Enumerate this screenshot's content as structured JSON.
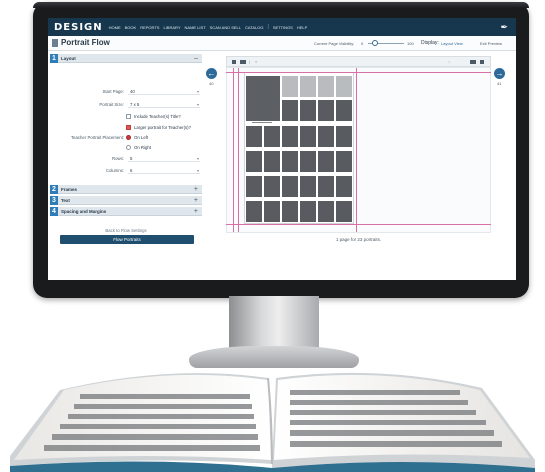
{
  "app": {
    "logo": "DESIGN",
    "nav": [
      "HOME",
      "BOOK",
      "REPORTS",
      "LIBRARY",
      "NAME LIST",
      "SCAN AND SELL",
      "CATALOG",
      "SETTINGS",
      "HELP"
    ],
    "nav_separator_after": 6
  },
  "header": {
    "title": "Portrait Flow",
    "visibility_label": "Current Page Visibility:",
    "visibility_min": "0",
    "visibility_max": "100",
    "visibility_value": 0.2,
    "display_label": "Display:",
    "layout_view": "Layout View",
    "exit_preview": "Exit Preview"
  },
  "sections": [
    {
      "num": "1",
      "label": "Layout",
      "toggle": "–"
    },
    {
      "num": "2",
      "label": "Frames",
      "toggle": "+"
    },
    {
      "num": "3",
      "label": "Text",
      "toggle": "+"
    },
    {
      "num": "4",
      "label": "Spacing and Margins",
      "toggle": "+"
    }
  ],
  "layout_form": {
    "start_page_label": "Start Page:",
    "start_page_value": "40",
    "portrait_size_label": "Portrait Size:",
    "portrait_size_value": "7 x 5",
    "include_teacher_title": "Include Teacher(s) Title?",
    "larger_portrait": "Larger portrait for Teacher(s)?",
    "teacher_placement_label": "Teacher Portrait Placement:",
    "placement_left": "On Left",
    "placement_right": "On Right",
    "rows_label": "Rows:",
    "rows_value": "5",
    "columns_label": "Columns:",
    "columns_value": "6"
  },
  "actions": {
    "back_link": "Back to Flow Settings",
    "flow_button": "Flow Portraits"
  },
  "preview": {
    "left_page": "40",
    "right_page": "41",
    "status": "1 page for 23 portraits."
  }
}
